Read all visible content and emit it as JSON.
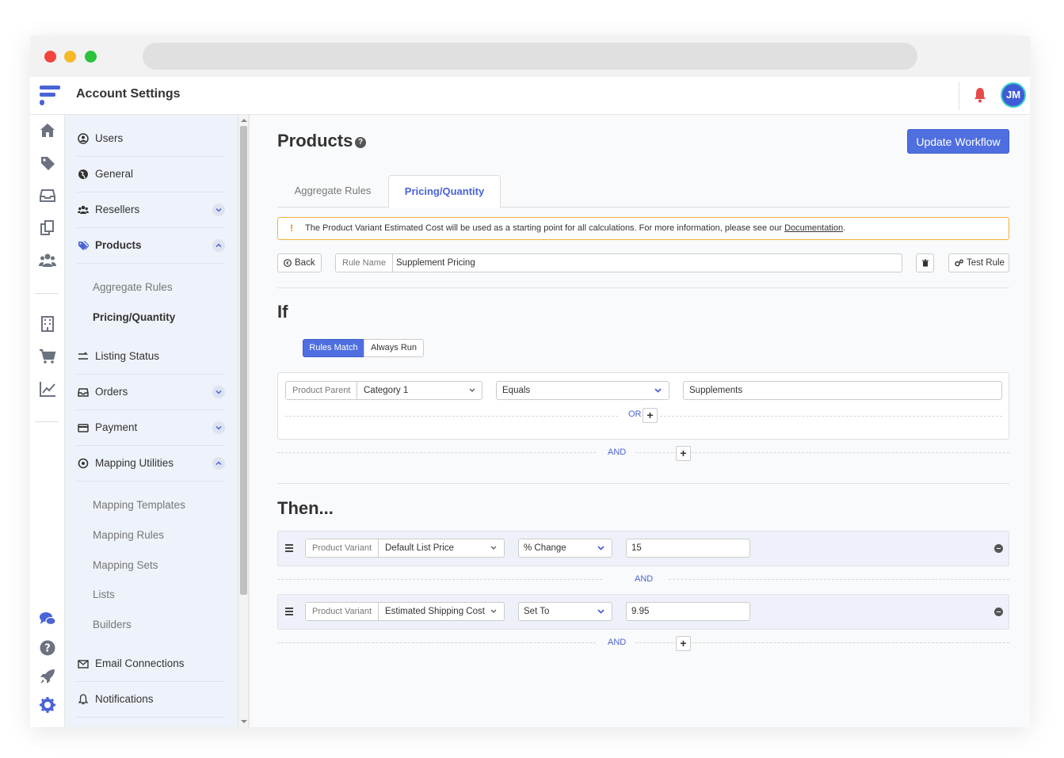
{
  "app": {
    "title": "Account Settings",
    "user_initials": "JM"
  },
  "sidebar": {
    "items": [
      {
        "label": "Users",
        "icon": "user-circle-icon"
      },
      {
        "label": "General",
        "icon": "globe-icon"
      },
      {
        "label": "Resellers",
        "icon": "users-icon"
      },
      {
        "label": "Products",
        "icon": "tags-icon"
      },
      {
        "label": "Listing Status",
        "icon": "exchange-icon"
      },
      {
        "label": "Orders",
        "icon": "inbox-icon"
      },
      {
        "label": "Payment",
        "icon": "credit-card-icon"
      },
      {
        "label": "Mapping Utilities",
        "icon": "compass-icon"
      },
      {
        "label": "Email Connections",
        "icon": "envelope-icon"
      },
      {
        "label": "Notifications",
        "icon": "bell-icon"
      }
    ],
    "products_sub": [
      "Aggregate Rules",
      "Pricing/Quantity"
    ],
    "mapping_sub": [
      "Mapping Templates",
      "Mapping Rules",
      "Mapping Sets",
      "Lists",
      "Builders"
    ]
  },
  "main": {
    "title": "Products",
    "update_button": "Update Workflow",
    "tabs": [
      "Aggregate Rules",
      "Pricing/Quantity"
    ],
    "alert": {
      "text": "The Product Variant Estimated Cost will be used as a starting point for all calculations. For more information, please see our ",
      "link": "Documentation",
      "suffix": "."
    },
    "toolbar": {
      "back": "Back",
      "rule_name_label": "Rule Name",
      "rule_name_value": "Supplement Pricing",
      "test_rule": "Test Rule"
    },
    "if": {
      "title": "If",
      "mode_on": "Rules Match",
      "mode_off": "Always Run",
      "condition": {
        "field_label": "Product Parent",
        "field_value": "Category 1",
        "operator": "Equals",
        "value": "Supplements"
      },
      "or_label": "OR",
      "and_label": "AND"
    },
    "then": {
      "title": "Then...",
      "actions": [
        {
          "field_label": "Product Variant",
          "field_value": "Default List Price",
          "operation": "% Change",
          "value": "15"
        },
        {
          "field_label": "Product Variant",
          "field_value": "Estimated Shipping Cost",
          "operation": "Set To",
          "value": "9.95"
        }
      ],
      "and_label": "AND"
    }
  },
  "colors": {
    "accent": "#4f6fe0",
    "alert_border": "#f3b03a",
    "bell": "#e84a4a"
  }
}
